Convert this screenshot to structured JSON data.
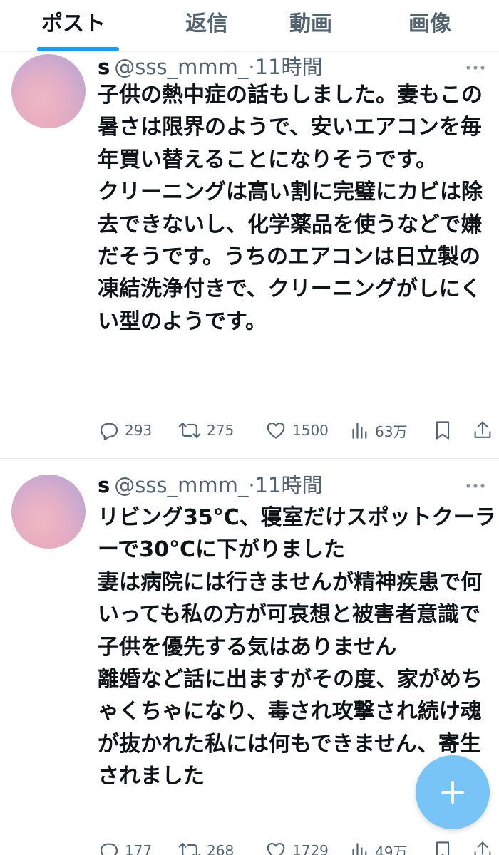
{
  "tabs": [
    {
      "label": "ポスト",
      "active": true
    },
    {
      "label": "返信",
      "active": false
    },
    {
      "label": "動画",
      "active": false
    },
    {
      "label": "画像",
      "active": false
    }
  ],
  "posts": [
    {
      "display_name": "s",
      "handle": "@sss_mmm_",
      "separator": "·",
      "time": "11時間",
      "text": "子供の熱中症の話もしました。妻もこの暑さは限界のようで、安いエアコンを毎年買い替えることになりそうです。\nクリーニングは高い割に完璧にカビは除去できないし、化学薬品を使うなどで嫌だそうです。うちのエアコンは日立製の凍結洗浄付きで、クリーニングがしにくい型のようです。",
      "replies": "293",
      "reposts": "275",
      "likes": "1500",
      "views": "63万"
    },
    {
      "display_name": "s",
      "handle": "@sss_mmm_",
      "separator": "·",
      "time": "11時間",
      "text": "リビング35°C、寝室だけスポットクーラーで30°Cに下がりました\n妻は病院には行きませんが精神疾患で何いっても私の方が可哀想と被害者意識で子供を優先する気はありません\n離婚など話に出ますがその度、家がめちゃくちゃになり、毒され攻撃され続け魂が抜かれた私には何もできません、寄生されました",
      "replies": "177",
      "reposts": "268",
      "likes": "1729",
      "views": "49万"
    }
  ],
  "colors": {
    "accent": "#1d9bf0",
    "fab": "#6ec0f6",
    "muted": "#536471",
    "text": "#0f1419",
    "divider": "#e6ecf0"
  },
  "icons": {
    "reply": "reply-icon",
    "repost": "repost-icon",
    "like": "heart-icon",
    "views": "views-icon",
    "bookmark": "bookmark-icon",
    "share": "share-icon",
    "more": "more-icon",
    "compose": "plus-icon"
  }
}
